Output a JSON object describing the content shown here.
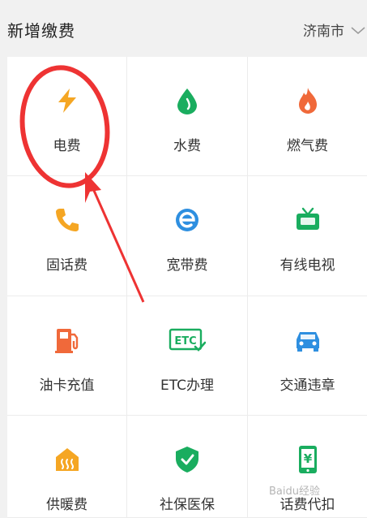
{
  "header": {
    "title": "新增缴费",
    "city": "济南市"
  },
  "services": [
    {
      "label": "电费",
      "icon": "lightning-icon",
      "color": "#f5a623"
    },
    {
      "label": "水费",
      "icon": "water-drop-icon",
      "color": "#1aad5f"
    },
    {
      "label": "燃气费",
      "icon": "flame-icon",
      "color": "#f0693a"
    },
    {
      "label": "固话费",
      "icon": "phone-icon",
      "color": "#f5a623"
    },
    {
      "label": "宽带费",
      "icon": "broadband-e-icon",
      "color": "#2e8fe0"
    },
    {
      "label": "有线电视",
      "icon": "tv-icon",
      "color": "#1aad5f"
    },
    {
      "label": "油卡充值",
      "icon": "fuel-pump-icon",
      "color": "#f0693a"
    },
    {
      "label": "ETC办理",
      "icon": "etc-card-icon",
      "color": "#1aad5f",
      "icon_text": "ETC"
    },
    {
      "label": "交通违章",
      "icon": "car-icon",
      "color": "#2e8fe0"
    },
    {
      "label": "供暖费",
      "icon": "heating-icon",
      "color": "#f5a623"
    },
    {
      "label": "社保医保",
      "icon": "shield-check-icon",
      "color": "#1aad5f"
    },
    {
      "label": "话费代扣",
      "icon": "mobile-yuan-icon",
      "color": "#1aad5f",
      "icon_text": "¥"
    }
  ],
  "annotation_color": "#ee3333",
  "watermark": "Baidu经验"
}
